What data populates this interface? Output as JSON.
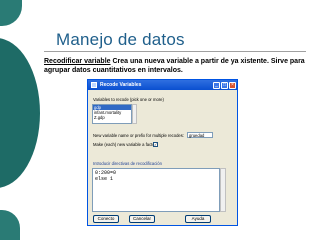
{
  "slide": {
    "title": "Manejo de datos",
    "keyword": "Recodificar variable",
    "body": "Crea una nueva variable a partir de ya xistente. Sirve para agrupar datos cuantitativos en intervalos."
  },
  "dialog": {
    "title": "Recode Variables",
    "variables_label": "Variables to recode (pick one or more)",
    "variables": [
      "gdp",
      "infant.mortality",
      "Z.gdp"
    ],
    "selected_variable": "gdp",
    "name_label": "New variable name or prefix for multiple recodes:",
    "name_value": "gruedad",
    "factor_label": "Make (each) new variable a factor",
    "factor_checked": true,
    "directives_label": "Introducir directivas de recodificación",
    "directives": [
      "0:200=0",
      "else 1"
    ],
    "buttons": {
      "ok": "Conecto",
      "cancel": "Cancelar",
      "help": "Ayuda"
    },
    "titlebar_buttons": {
      "minimize": "_",
      "maximize": "□",
      "close": "×"
    }
  }
}
